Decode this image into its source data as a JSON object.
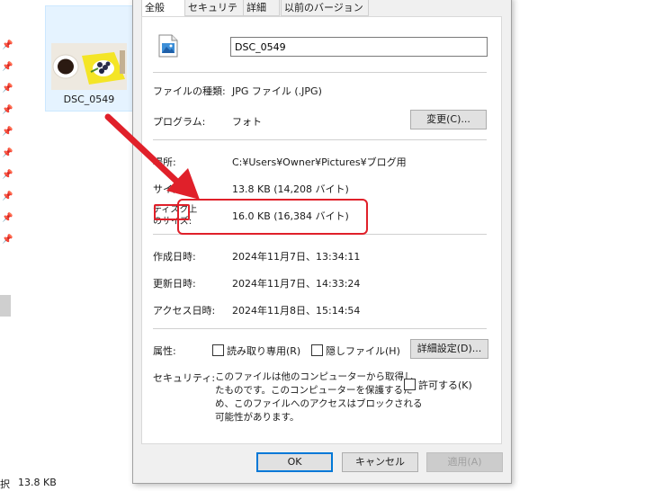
{
  "explorer": {
    "file_name": "DSC_0549",
    "status_selected": "択",
    "status_size": "13.8 KB"
  },
  "dialog": {
    "tabs": [
      "全般",
      "セキュリティ",
      "詳細",
      "以前のバージョン"
    ],
    "file_name_value": "DSC_0549",
    "file_type_label": "ファイルの種類:",
    "file_type_value": "JPG ファイル (.JPG)",
    "program_label": "プログラム:",
    "program_value": "フォト",
    "change_button": "変更(C)...",
    "location_label": "場所:",
    "location_value": "C:¥Users¥Owner¥Pictures¥ブログ用",
    "size_label": "サイズ:",
    "size_value": "13.8 KB (14,208 バイト)",
    "disk_size_label_1": "ディスク上",
    "disk_size_label_2": "のサイズ:",
    "disk_size_value": "16.0 KB (16,384 バイト)",
    "created_label": "作成日時:",
    "created_value": "2024年11月7日、13:34:11",
    "modified_label": "更新日時:",
    "modified_value": "2024年11月7日、14:33:24",
    "accessed_label": "アクセス日時:",
    "accessed_value": "2024年11月8日、15:14:54",
    "attributes_label": "属性:",
    "readonly_label": "読み取り専用(R)",
    "hidden_label": "隠しファイル(H)",
    "advanced_button": "詳細設定(D)...",
    "security_label": "セキュリティ:",
    "security_text_1": "このファイルは他のコンピューターから取得し",
    "security_text_2": "たものです。このコンピューターを保護するた",
    "security_text_3": "め、このファイルへのアクセスはブロックされる",
    "security_text_4": "可能性があります。",
    "allow_label": "許可する(K)",
    "ok_button": "OK",
    "cancel_button": "キャンセル",
    "apply_button": "適用(A)"
  },
  "colors": {
    "highlight": "#e0202a",
    "accent": "#0078d7"
  }
}
